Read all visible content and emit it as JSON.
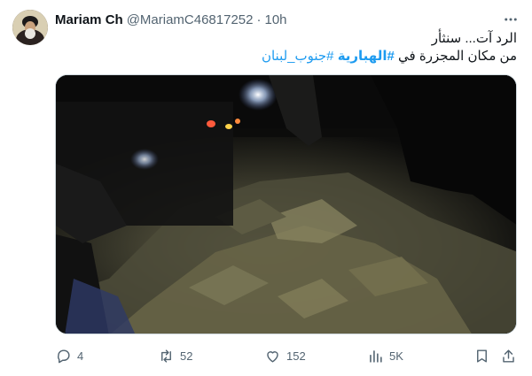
{
  "tweet": {
    "display_name": "Mariam Ch",
    "handle": "@MariamC46817252",
    "separator": "·",
    "time": "10h",
    "text_line1": "الرد آت... سنثأر",
    "text_line2_prefix": "من مكان المجزرة في ",
    "hashtag1": "#الهبارية",
    "hashtag2": "#جنوب_لبنان"
  },
  "actions": {
    "replies": "4",
    "retweets": "52",
    "likes": "152",
    "views": "5K"
  },
  "icons": [
    "more-icon",
    "reply-icon",
    "retweet-icon",
    "like-icon",
    "views-icon",
    "bookmark-icon",
    "share-icon"
  ],
  "colors": {
    "accent": "#1d9bf0",
    "text": "#0f1419",
    "muted": "#536471"
  }
}
